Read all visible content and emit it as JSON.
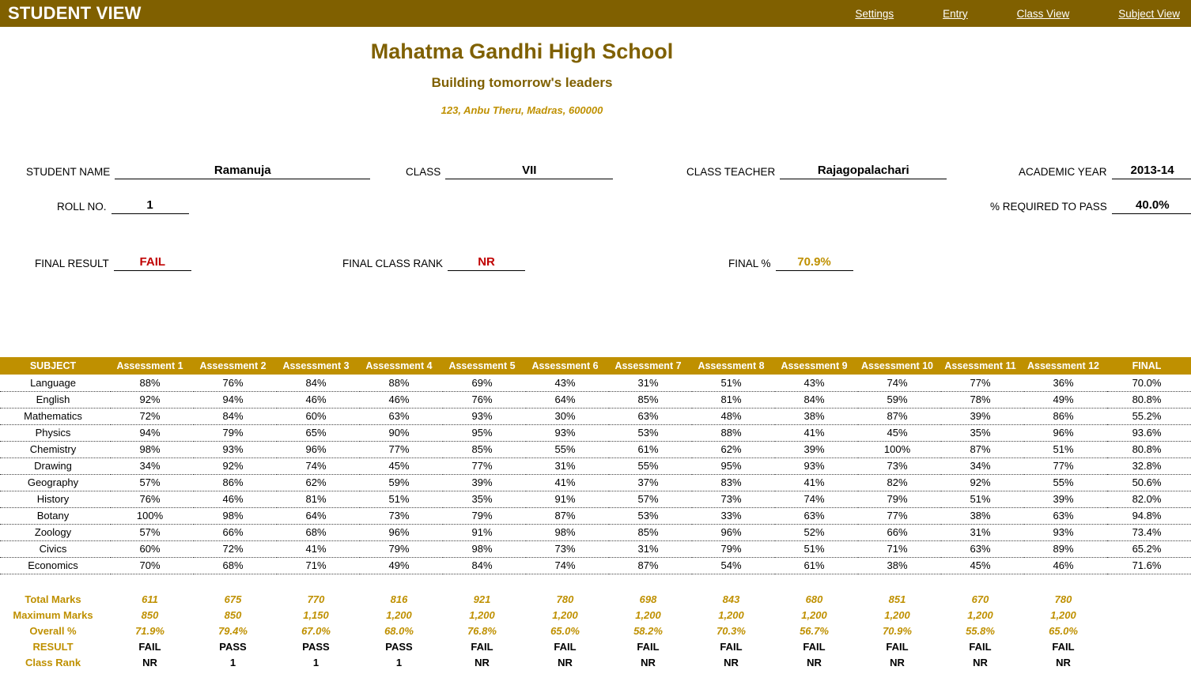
{
  "topbar": {
    "title": "STUDENT VIEW",
    "links": [
      {
        "label": "Settings"
      },
      {
        "label": "Entry"
      },
      {
        "label": "Class View"
      },
      {
        "label": "Subject View"
      }
    ]
  },
  "school": {
    "name": "Mahatma Gandhi High School",
    "tagline": "Building tomorrow's leaders",
    "address": "123, Anbu Theru, Madras, 600000"
  },
  "info": {
    "student_name_label": "STUDENT NAME",
    "student_name_value": "Ramanuja",
    "class_label": "CLASS",
    "class_value": "VII",
    "class_teacher_label": "CLASS TEACHER",
    "class_teacher_value": "Rajagopalachari",
    "academic_year_label": "ACADEMIC YEAR",
    "academic_year_value": "2013-14",
    "roll_no_label": "ROLL NO.",
    "roll_no_value": "1",
    "pct_required_label": "% REQUIRED TO PASS",
    "pct_required_value": "40.0%",
    "final_result_label": "FINAL RESULT",
    "final_result_value": "FAIL",
    "final_rank_label": "FINAL CLASS RANK",
    "final_rank_value": "NR",
    "final_pct_label": "FINAL %",
    "final_pct_value": "70.9%"
  },
  "colors": {
    "topbar_bg": "#806000",
    "table_header_bg": "#BF9000",
    "school_name": "#7F6000",
    "gold_text": "#BF9000",
    "fail_red": "#C00000",
    "pass_green": "#375623"
  },
  "table": {
    "headers": [
      "SUBJECT",
      "Assessment 1",
      "Assessment 2",
      "Assessment 3",
      "Assessment 4",
      "Assessment 5",
      "Assessment 6",
      "Assessment 7",
      "Assessment 8",
      "Assessment 9",
      "Assessment 10",
      "Assessment 11",
      "Assessment 12",
      "FINAL"
    ],
    "rows": [
      {
        "subject": "Language",
        "scores": [
          "88%",
          "76%",
          "84%",
          "88%",
          "69%",
          "43%",
          "31%",
          "51%",
          "43%",
          "74%",
          "77%",
          "36%"
        ],
        "fails": [
          6,
          11
        ],
        "final": "70.0%",
        "final_fail": false
      },
      {
        "subject": "English",
        "scores": [
          "92%",
          "94%",
          "46%",
          "46%",
          "76%",
          "64%",
          "85%",
          "81%",
          "84%",
          "59%",
          "78%",
          "49%"
        ],
        "fails": [],
        "final": "80.8%",
        "final_fail": false
      },
      {
        "subject": "Mathematics",
        "scores": [
          "72%",
          "84%",
          "60%",
          "63%",
          "93%",
          "30%",
          "63%",
          "48%",
          "38%",
          "87%",
          "39%",
          "86%"
        ],
        "fails": [
          5,
          8,
          10
        ],
        "final": "55.2%",
        "final_fail": false
      },
      {
        "subject": "Physics",
        "scores": [
          "94%",
          "79%",
          "65%",
          "90%",
          "95%",
          "93%",
          "53%",
          "88%",
          "41%",
          "45%",
          "35%",
          "96%"
        ],
        "fails": [
          10
        ],
        "final": "93.6%",
        "final_fail": false
      },
      {
        "subject": "Chemistry",
        "scores": [
          "98%",
          "93%",
          "96%",
          "77%",
          "85%",
          "55%",
          "61%",
          "62%",
          "39%",
          "100%",
          "87%",
          "51%"
        ],
        "fails": [
          8
        ],
        "final": "80.8%",
        "final_fail": false
      },
      {
        "subject": "Drawing",
        "scores": [
          "34%",
          "92%",
          "74%",
          "45%",
          "77%",
          "31%",
          "55%",
          "95%",
          "93%",
          "73%",
          "34%",
          "77%"
        ],
        "fails": [
          0,
          5,
          10
        ],
        "final": "32.8%",
        "final_fail": true
      },
      {
        "subject": "Geography",
        "scores": [
          "57%",
          "86%",
          "62%",
          "59%",
          "39%",
          "41%",
          "37%",
          "83%",
          "41%",
          "82%",
          "92%",
          "55%"
        ],
        "fails": [
          4,
          6
        ],
        "final": "50.6%",
        "final_fail": false
      },
      {
        "subject": "History",
        "scores": [
          "76%",
          "46%",
          "81%",
          "51%",
          "35%",
          "91%",
          "57%",
          "73%",
          "74%",
          "79%",
          "51%",
          "39%"
        ],
        "fails": [
          4,
          11
        ],
        "final": "82.0%",
        "final_fail": false
      },
      {
        "subject": "Botany",
        "scores": [
          "100%",
          "98%",
          "64%",
          "73%",
          "79%",
          "87%",
          "53%",
          "33%",
          "63%",
          "77%",
          "38%",
          "63%"
        ],
        "fails": [
          7,
          10
        ],
        "final": "94.8%",
        "final_fail": false
      },
      {
        "subject": "Zoology",
        "scores": [
          "57%",
          "66%",
          "68%",
          "96%",
          "91%",
          "98%",
          "85%",
          "96%",
          "52%",
          "66%",
          "31%",
          "93%"
        ],
        "fails": [
          10
        ],
        "final": "73.4%",
        "final_fail": false
      },
      {
        "subject": "Civics",
        "scores": [
          "60%",
          "72%",
          "41%",
          "79%",
          "98%",
          "73%",
          "31%",
          "79%",
          "51%",
          "71%",
          "63%",
          "89%"
        ],
        "fails": [
          6
        ],
        "final": "65.2%",
        "final_fail": false
      },
      {
        "subject": "Economics",
        "scores": [
          "70%",
          "68%",
          "71%",
          "49%",
          "84%",
          "74%",
          "87%",
          "54%",
          "61%",
          "38%",
          "45%",
          "46%"
        ],
        "fails": [
          9
        ],
        "final": "71.6%",
        "final_fail": false
      }
    ],
    "summary": {
      "total_marks_label": "Total Marks",
      "total_marks": [
        "611",
        "675",
        "770",
        "816",
        "921",
        "780",
        "698",
        "843",
        "680",
        "851",
        "670",
        "780"
      ],
      "maximum_marks_label": "Maximum Marks",
      "maximum_marks": [
        "850",
        "850",
        "1,150",
        "1,200",
        "1,200",
        "1,200",
        "1,200",
        "1,200",
        "1,200",
        "1,200",
        "1,200",
        "1,200"
      ],
      "overall_pct_label": "Overall %",
      "overall_pct": [
        "71.9%",
        "79.4%",
        "67.0%",
        "68.0%",
        "76.8%",
        "65.0%",
        "58.2%",
        "70.3%",
        "56.7%",
        "70.9%",
        "55.8%",
        "65.0%"
      ],
      "result_label": "RESULT",
      "result": [
        "FAIL",
        "PASS",
        "PASS",
        "PASS",
        "FAIL",
        "FAIL",
        "FAIL",
        "FAIL",
        "FAIL",
        "FAIL",
        "FAIL",
        "FAIL"
      ],
      "class_rank_label": "Class Rank",
      "class_rank": [
        "NR",
        "1",
        "1",
        "1",
        "NR",
        "NR",
        "NR",
        "NR",
        "NR",
        "NR",
        "NR",
        "NR"
      ]
    }
  }
}
